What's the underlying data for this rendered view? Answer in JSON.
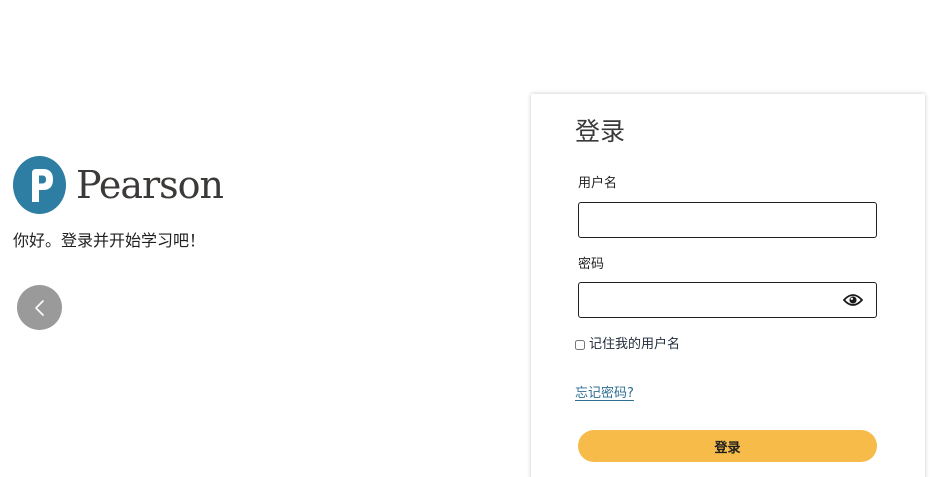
{
  "brand": {
    "name": "Pearson",
    "logo_icon": "pearson-p-logo-icon",
    "logo_color": "#2e7da3"
  },
  "hero": {
    "greeting": "你好。登录并开始学习吧！",
    "prev_icon": "chevron-left-icon"
  },
  "login": {
    "title": "登录",
    "username_label": "用户名",
    "username_value": "",
    "password_label": "密码",
    "password_value": "",
    "show_password_icon": "eye-icon",
    "remember_label": "记住我的用户名",
    "remember_checked": false,
    "forgot_link": "忘记密码?",
    "submit_label": "登录",
    "submit_color": "#f6bb48",
    "link_color": "#2d6f93"
  }
}
